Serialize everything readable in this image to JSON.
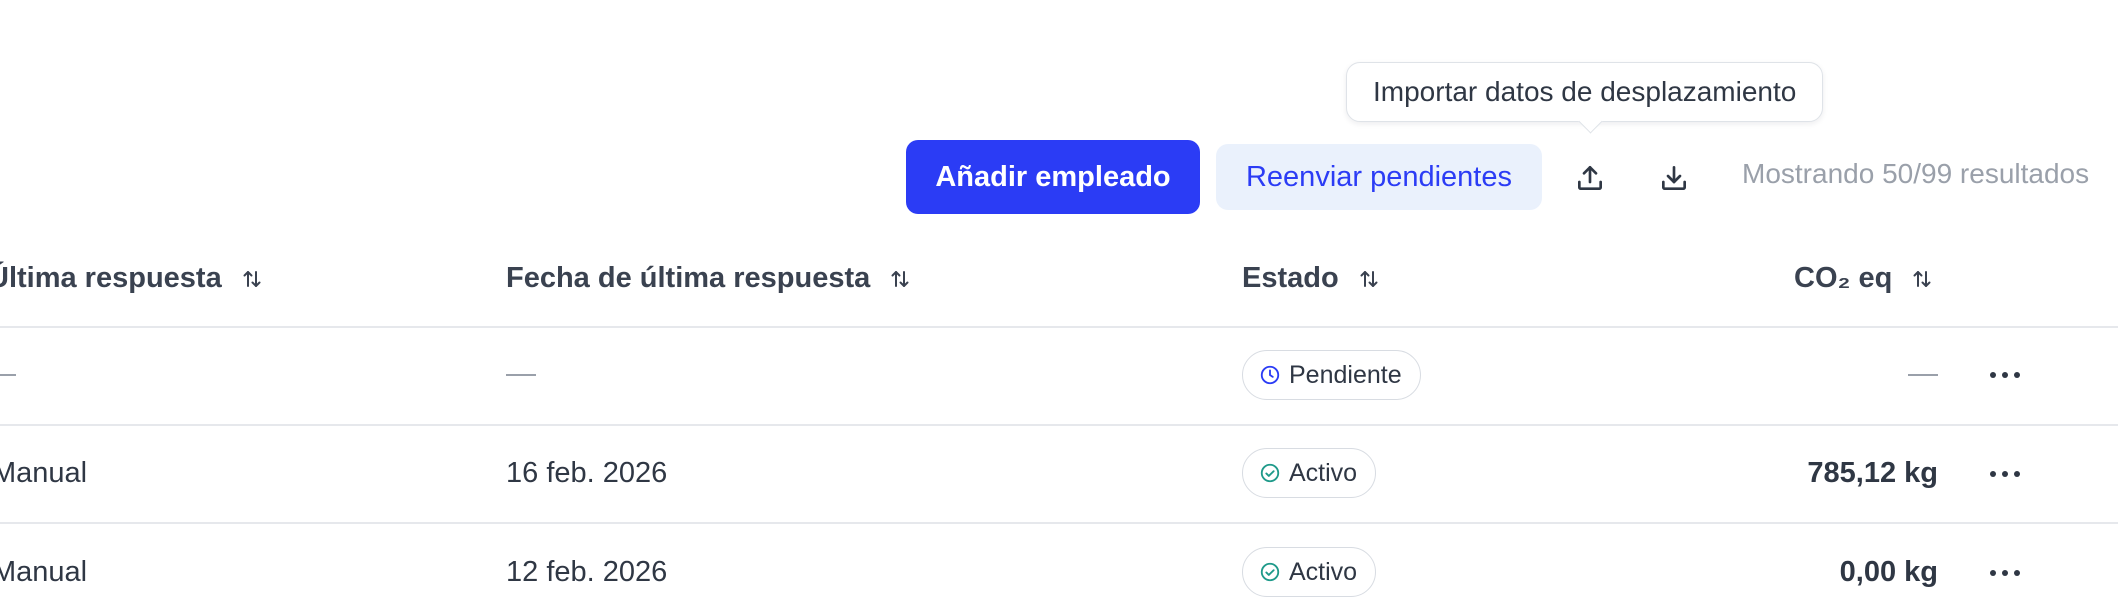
{
  "tooltip": {
    "text": "Importar datos de desplazamiento"
  },
  "toolbar": {
    "add_employee_label": "Añadir empleado",
    "resend_pending_label": "Reenviar pendientes",
    "upload_icon": "upload-icon",
    "download_icon": "download-icon",
    "results_text": "Mostrando 50/99 resultados"
  },
  "colors": {
    "primary": "#2b3cf5",
    "secondary_bg": "#eaf1fc",
    "pending_icon": "#2b3cf5",
    "active_icon": "#1f9a8a",
    "muted": "#9aa0aa"
  },
  "table": {
    "headers": {
      "last_response": "Última respuesta",
      "last_response_date": "Fecha de última respuesta",
      "status": "Estado",
      "co2": "CO₂ eq"
    },
    "rows": [
      {
        "last_response": "—",
        "date": "—",
        "status": "Pendiente",
        "status_icon": "clock-icon",
        "co2": "—"
      },
      {
        "last_response": "Manual",
        "date": "16 feb. 2026",
        "status": "Activo",
        "status_icon": "check-circle-icon",
        "co2": "785,12 kg"
      },
      {
        "last_response": "Manual",
        "date": "12 feb. 2026",
        "status": "Activo",
        "status_icon": "check-circle-icon",
        "co2": "0,00 kg"
      }
    ]
  }
}
